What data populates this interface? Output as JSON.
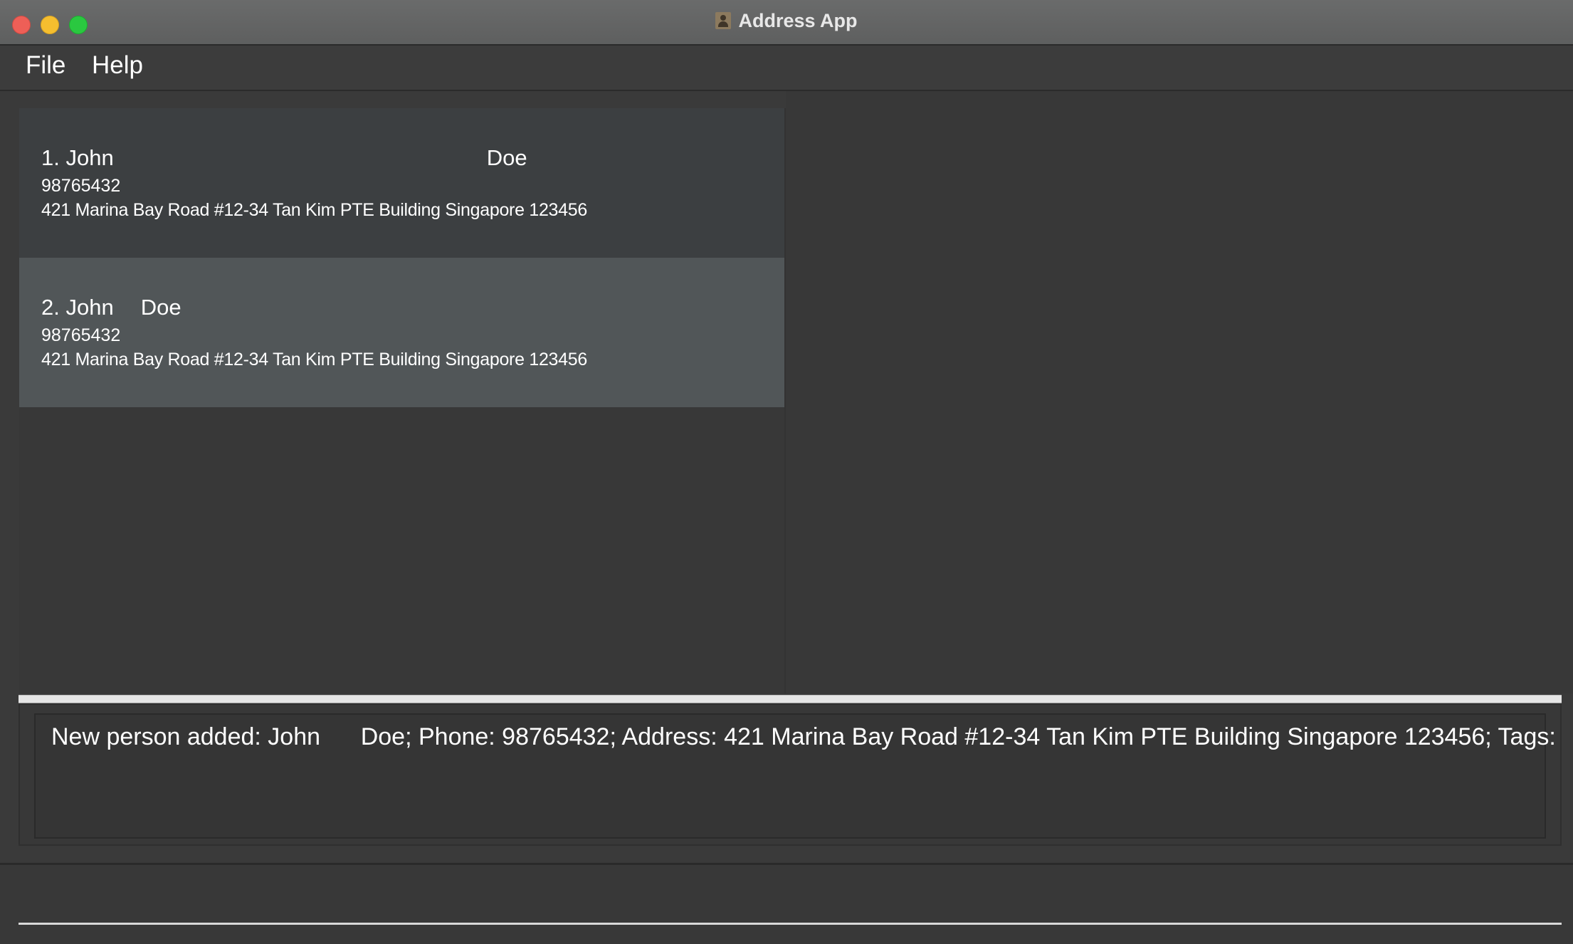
{
  "window": {
    "title": "Address App"
  },
  "menu": {
    "items": [
      {
        "label": "File"
      },
      {
        "label": "Help"
      }
    ]
  },
  "persons": [
    {
      "index": "1.",
      "first": "John",
      "last": "Doe",
      "phone": "98765432",
      "address": "421 Marina Bay Road #12-34 Tan Kim PTE Building Singapore 123456"
    },
    {
      "index": "2.",
      "first": "John",
      "last": "Doe",
      "phone": "98765432",
      "address": "421 Marina Bay Road #12-34 Tan Kim PTE Building Singapore 123456"
    }
  ],
  "result": {
    "message": "New person added: John      Doe; Phone: 98765432; Address: 421 Marina Bay Road #12-34 Tan Kim PTE Building Singapore 123456; Tags:"
  },
  "colors": {
    "close": "#ee5f57",
    "minimize": "#f5be2f",
    "maximize": "#2ac840",
    "selected_card": "#515658",
    "card": "#3c3f41"
  },
  "icons": {
    "app": "address-book-icon"
  }
}
